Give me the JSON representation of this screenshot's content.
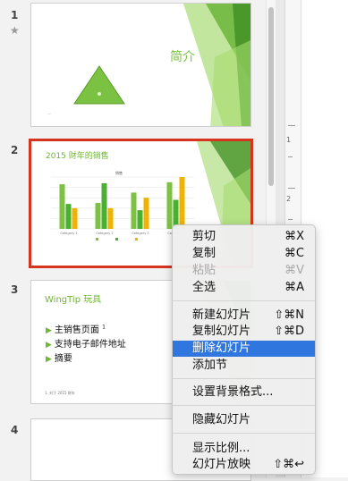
{
  "slides": [
    {
      "number": "1",
      "title": "简介"
    },
    {
      "number": "2",
      "title": "2015 财年的销售",
      "chart_data": {
        "type": "bar",
        "title": "销售",
        "categories": [
          "Category 1",
          "Category 2",
          "Category 3",
          "Category 4"
        ],
        "series": [
          {
            "values": [
              4.3,
              2.5,
              3.5,
              4.5
            ]
          },
          {
            "values": [
              2.4,
              4.4,
              1.8,
              2.8
            ]
          },
          {
            "values": [
              2.0,
              2.0,
              3.0,
              5.0
            ]
          }
        ],
        "colors": [
          "#7cc242",
          "#4caf35",
          "#f0b400"
        ],
        "ylim": [
          0,
          5
        ]
      }
    },
    {
      "number": "3",
      "title": "WingTip 玩具",
      "bullets": [
        "主销售页面",
        "支持电子邮件地址",
        "摘要"
      ],
      "bullet_sup": "1",
      "footnote": "1. 对于 2015 财年"
    },
    {
      "number": "4",
      "title": ""
    }
  ],
  "context_menu": {
    "items": [
      {
        "label": "剪切",
        "shortcut": "⌘X",
        "state": "normal"
      },
      {
        "label": "复制",
        "shortcut": "⌘C",
        "state": "normal"
      },
      {
        "label": "粘贴",
        "shortcut": "⌘V",
        "state": "disabled"
      },
      {
        "label": "全选",
        "shortcut": "⌘A",
        "state": "normal"
      },
      {
        "label": "新建幻灯片",
        "shortcut": "⇧⌘N",
        "state": "normal"
      },
      {
        "label": "复制幻灯片",
        "shortcut": "⇧⌘D",
        "state": "normal"
      },
      {
        "label": "删除幻灯片",
        "shortcut": "",
        "state": "highlighted"
      },
      {
        "label": "添加节",
        "shortcut": "",
        "state": "normal"
      },
      {
        "label": "设置背景格式...",
        "shortcut": "",
        "state": "normal"
      },
      {
        "label": "隐藏幻灯片",
        "shortcut": "",
        "state": "normal"
      },
      {
        "label": "显示比例...",
        "shortcut": "",
        "state": "normal"
      },
      {
        "label": "幻灯片放映",
        "shortcut": "⇧⌘↩",
        "state": "normal"
      }
    ]
  },
  "ruler": {
    "numbers": [
      "1",
      "2"
    ]
  },
  "icons": {
    "favorite": "star-icon",
    "bullet": "triangle-bullet-icon"
  },
  "colors": {
    "accent_green": "#7cc242",
    "selection_border": "#d5341f",
    "menu_highlight": "#2f76de"
  }
}
